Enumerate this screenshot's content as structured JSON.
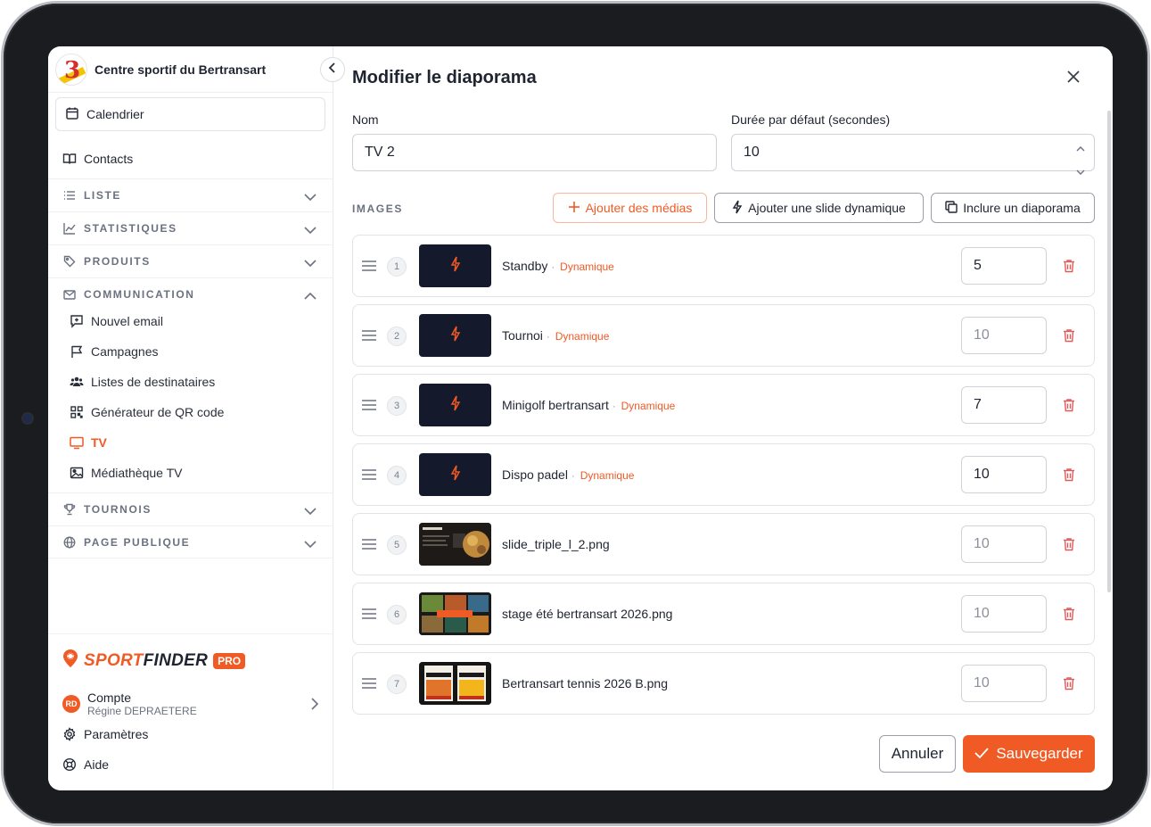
{
  "sidebar": {
    "org_name": "Centre sportif du Bertransart",
    "calendar_label": "Calendrier",
    "contacts_label": "Contacts",
    "sections": [
      {
        "label": "LISTE",
        "icon": "list-icon"
      },
      {
        "label": "STATISTIQUES",
        "icon": "chart-icon"
      },
      {
        "label": "PRODUITS",
        "icon": "tag-icon"
      },
      {
        "label": "COMMUNICATION",
        "icon": "mail-icon"
      },
      {
        "label": "TOURNOIS",
        "icon": "trophy-icon"
      },
      {
        "label": "PAGE PUBLIQUE",
        "icon": "globe-icon"
      }
    ],
    "communication_items": [
      {
        "label": "Nouvel email",
        "icon": "message-plus-icon"
      },
      {
        "label": "Campagnes",
        "icon": "flag-icon"
      },
      {
        "label": "Listes de destinataires",
        "icon": "users-icon"
      },
      {
        "label": "Générateur de QR code",
        "icon": "qr-code-icon"
      },
      {
        "label": "TV",
        "icon": "tv-icon",
        "active": true
      },
      {
        "label": "Médiathèque TV",
        "icon": "image-icon"
      }
    ],
    "footer": {
      "brand_part1": "SPORT",
      "brand_part2": "FINDER",
      "badge": "PRO",
      "account_title": "Compte",
      "account_user": "Régine DEPRAETERE",
      "avatar_initials": "RD",
      "settings_label": "Paramètres",
      "help_label": "Aide"
    }
  },
  "modal": {
    "title": "Modifier le diaporama",
    "name_label": "Nom",
    "name_value": "TV 2",
    "duration_label": "Durée par défaut (secondes)",
    "duration_value": "10",
    "images_label": "IMAGES",
    "add_media_label": "Ajouter des médias",
    "add_dynamic_label": "Ajouter une slide dynamique",
    "include_slideshow_label": "Inclure un diaporama",
    "dynamic_tag": "Dynamique",
    "slides": [
      {
        "index": "1",
        "name": "Standby",
        "dynamic": true,
        "duration": "5",
        "placeholder": false
      },
      {
        "index": "2",
        "name": "Tournoi",
        "dynamic": true,
        "duration": "10",
        "placeholder": true
      },
      {
        "index": "3",
        "name": "Minigolf bertransart",
        "dynamic": true,
        "duration": "7",
        "placeholder": false
      },
      {
        "index": "4",
        "name": "Dispo padel",
        "dynamic": true,
        "duration": "10",
        "placeholder": false
      },
      {
        "index": "5",
        "name": "slide_triple_l_2.png",
        "dynamic": false,
        "duration": "10",
        "placeholder": true
      },
      {
        "index": "6",
        "name": "stage été bertransart 2026.png",
        "dynamic": false,
        "duration": "10",
        "placeholder": true
      },
      {
        "index": "7",
        "name": "Bertransart tennis 2026 B.png",
        "dynamic": false,
        "duration": "10",
        "placeholder": true
      }
    ],
    "cancel_label": "Annuler",
    "save_label": "Sauvegarder"
  },
  "colors": {
    "accent": "#f05a24",
    "border": "#cfd3d9",
    "muted": "#6b7180"
  }
}
